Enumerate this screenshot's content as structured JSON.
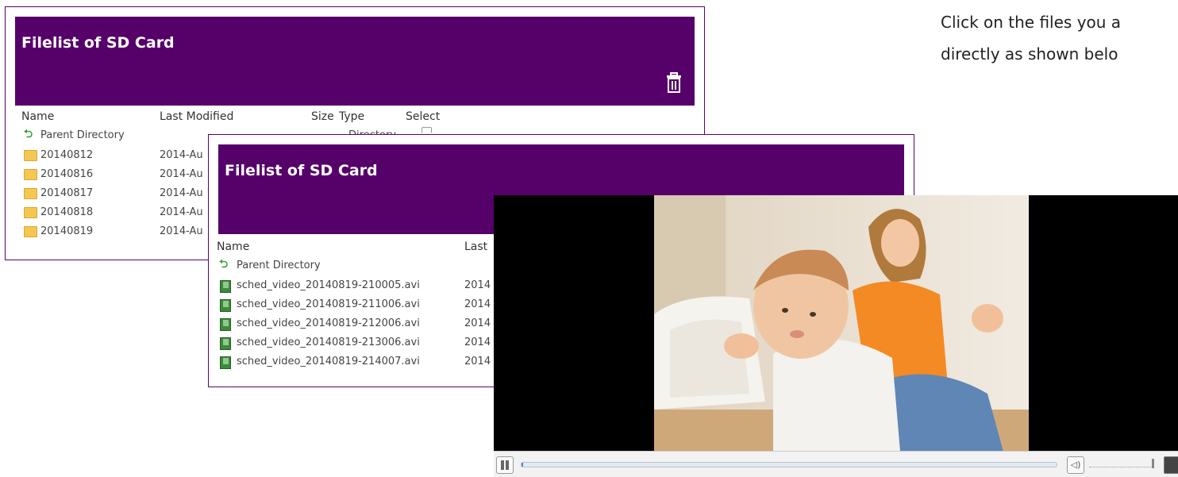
{
  "instructions": {
    "line1": "Click on the files you a",
    "line2": "directly as shown belo"
  },
  "folder_panel": {
    "title": "Filelist of SD Card",
    "columns": {
      "name": "Name",
      "modified": "Last Modified",
      "size": "Size",
      "type": "Type",
      "select": "Select"
    },
    "parent": {
      "name": "Parent Directory",
      "type": "Directory"
    },
    "rows": [
      {
        "name": "20140812",
        "modified": "2014-Au"
      },
      {
        "name": "20140816",
        "modified": "2014-Au"
      },
      {
        "name": "20140817",
        "modified": "2014-Au"
      },
      {
        "name": "20140818",
        "modified": "2014-Au"
      },
      {
        "name": "20140819",
        "modified": "2014-Au"
      }
    ]
  },
  "file_panel": {
    "title": "Filelist of SD Card",
    "columns": {
      "name": "Name",
      "modified": "Last"
    },
    "parent": {
      "name": "Parent Directory"
    },
    "rows": [
      {
        "name": "sched_video_20140819-210005.avi",
        "modified": "2014"
      },
      {
        "name": "sched_video_20140819-211006.avi",
        "modified": "2014"
      },
      {
        "name": "sched_video_20140819-212006.avi",
        "modified": "2014"
      },
      {
        "name": "sched_video_20140819-213006.avi",
        "modified": "2014"
      },
      {
        "name": "sched_video_20140819-214007.avi",
        "modified": "2014"
      }
    ]
  },
  "player": {
    "progress": 0.003,
    "volume": 1.0,
    "icons": [
      "pause-icon",
      "volume-icon",
      "fullscreen-icon"
    ]
  },
  "colors": {
    "header": "#56006a",
    "border": "#5b0068"
  }
}
